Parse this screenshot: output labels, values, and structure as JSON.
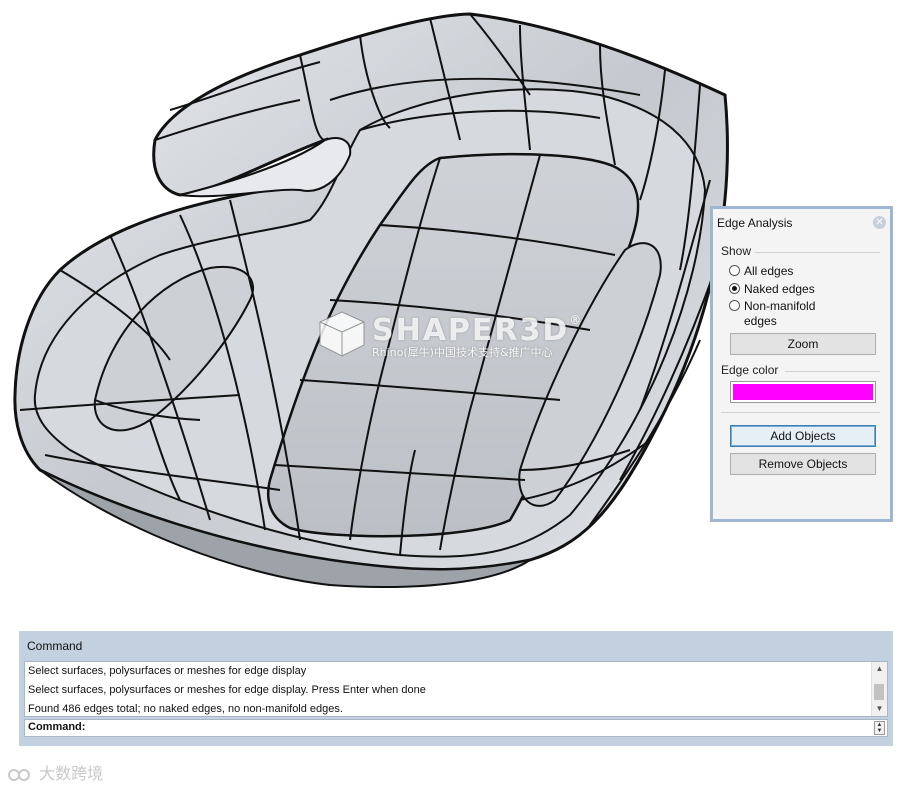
{
  "viewport": {
    "watermark_title": "SHAPER3D",
    "watermark_registered": "®",
    "watermark_subtitle": "Rhino(犀牛)中国技术支持&推广中心"
  },
  "edge_analysis": {
    "title": "Edge Analysis",
    "close_icon": "close-icon",
    "show_group": "Show",
    "options": [
      {
        "label": "All edges",
        "checked": false
      },
      {
        "label": "Naked edges",
        "checked": true
      },
      {
        "label": "Non-manifold",
        "checked": false
      }
    ],
    "option3_continued": "edges",
    "zoom_button": "Zoom",
    "edge_color_group": "Edge color",
    "edge_color": "#ff00ff",
    "add_objects_button": "Add Objects",
    "remove_objects_button": "Remove Objects"
  },
  "command": {
    "title": "Command",
    "history": [
      "Select surfaces, polysurfaces or meshes for edge display",
      "Select surfaces, polysurfaces or meshes for edge display. Press Enter when done",
      "Found 486 edges total; no naked edges, no non-manifold edges."
    ],
    "prompt": "Command:",
    "scroll_up_icon": "▲",
    "scroll_down_icon": "▼"
  },
  "corner_watermark": {
    "text": "大数跨境",
    "logo_icon": "brand-logo-icon"
  }
}
